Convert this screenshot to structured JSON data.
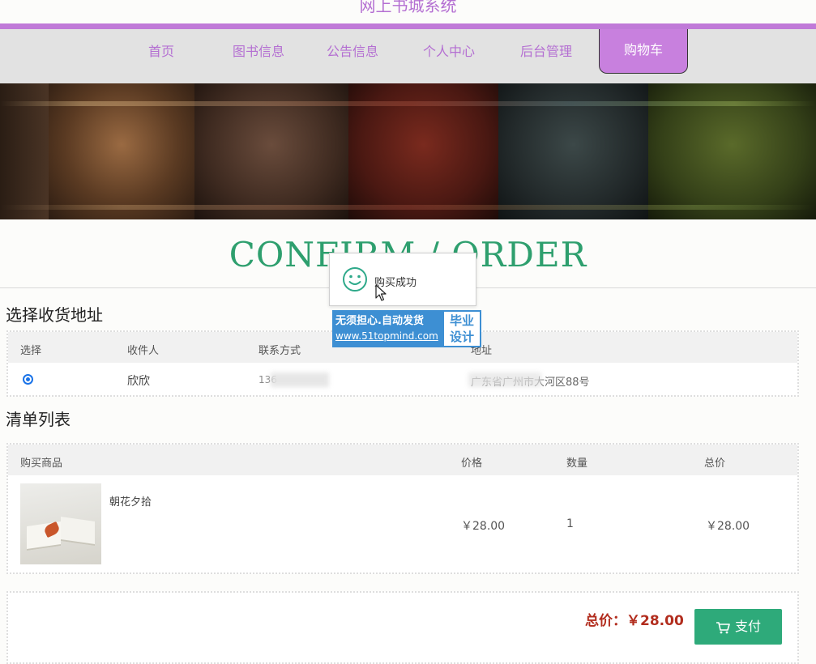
{
  "site": {
    "title": "网上书城系统"
  },
  "nav": {
    "items": [
      {
        "label": "首页"
      },
      {
        "label": "图书信息"
      },
      {
        "label": "公告信息"
      },
      {
        "label": "个人中心"
      },
      {
        "label": "后台管理"
      },
      {
        "label": "购物车"
      }
    ],
    "active": "购物车"
  },
  "colors": {
    "accent": "#c880de",
    "green": "#2eaa7a",
    "price_red": "#b22d1e"
  },
  "confirm_title": "CONFIRM / ORDER",
  "address": {
    "section_title": "选择收货地址",
    "headers": [
      "选择",
      "收件人",
      "联系方式",
      "地址"
    ],
    "rows": [
      {
        "selected": true,
        "name": "欣欣",
        "phone": "136",
        "address": "广东省广州市大河区88号"
      }
    ]
  },
  "orders": {
    "section_title": "清单列表",
    "headers": [
      "购买商品",
      "价格",
      "数量",
      "总价"
    ],
    "rows": [
      {
        "title": "朝花夕拾",
        "price": "￥28.00",
        "qty": "1",
        "total": "￥28.00"
      }
    ]
  },
  "summary": {
    "label": "总价：",
    "amount": "￥28.00",
    "pay_label": "支付"
  },
  "toast": {
    "message": "购买成功"
  },
  "watermark": {
    "line1": "无须担心.自动发货",
    "url": "www.51topmind.com",
    "tag1": "毕业",
    "tag2": "设计"
  }
}
